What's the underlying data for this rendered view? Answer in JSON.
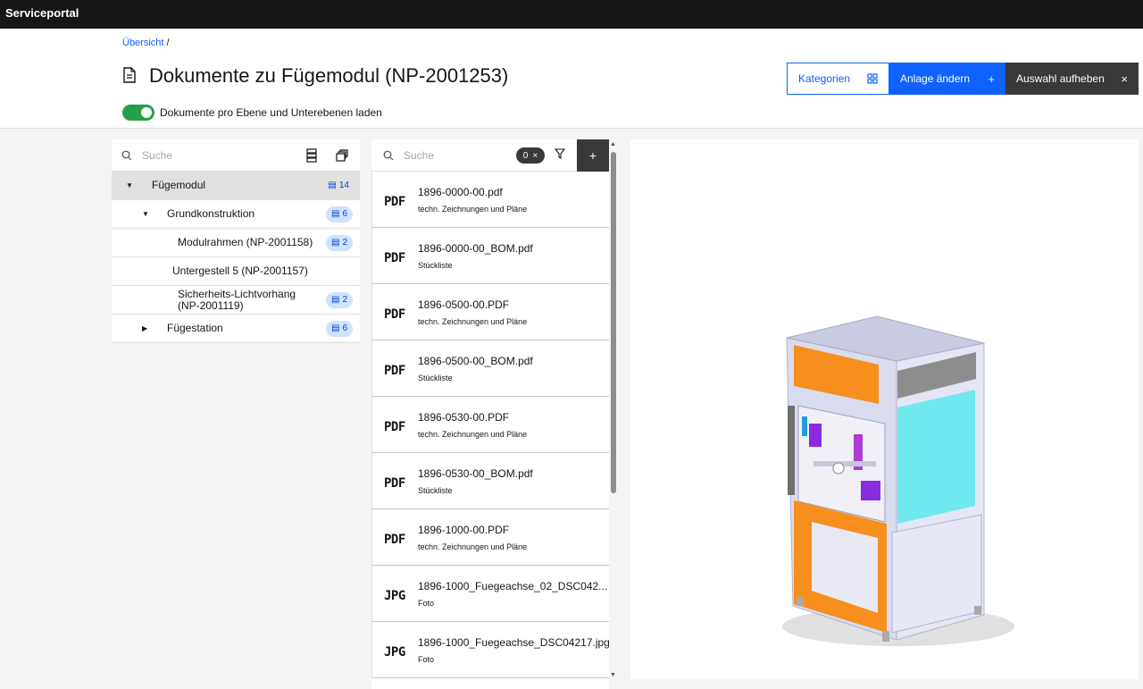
{
  "app": {
    "title": "Serviceportal"
  },
  "breadcrumb": {
    "link": "Übersicht",
    "separator": "/"
  },
  "page": {
    "title": "Dokumente zu Fügemodul (NP-2001253)"
  },
  "toggle": {
    "label": "Dokumente pro Ebene und Unterebenen laden",
    "checked": true
  },
  "actions": {
    "categories": "Kategorien",
    "change": "Anlage ändern",
    "change_icon": "+",
    "clear": "Auswahl aufheben",
    "clear_icon": "×"
  },
  "tree": {
    "search_placeholder": "Suche",
    "items": [
      {
        "label": "Fügemodul",
        "count": "14",
        "caret": "▼"
      },
      {
        "label": "Grundkonstruktion",
        "count": "6",
        "caret": "▼"
      },
      {
        "label": "Modulrahmen (NP-2001158)",
        "count": "2"
      },
      {
        "label": "Untergestell 5 (NP-2001157)"
      },
      {
        "label": "Sicherheits-Lichtvorhang (NP-2001119)",
        "count": "2"
      },
      {
        "label": "Fügestation",
        "count": "6",
        "caret": "▶"
      }
    ]
  },
  "documents": {
    "search_placeholder": "Suche",
    "filter_count": "0",
    "filter_clear": "×",
    "add": "+",
    "items": [
      {
        "type": "PDF",
        "name": "1896-0000-00.pdf",
        "category": "techn. Zeichnungen und Pläne"
      },
      {
        "type": "PDF",
        "name": "1896-0000-00_BOM.pdf",
        "category": "Stückliste"
      },
      {
        "type": "PDF",
        "name": "1896-0500-00.PDF",
        "category": "techn. Zeichnungen und Pläne"
      },
      {
        "type": "PDF",
        "name": "1896-0500-00_BOM.pdf",
        "category": "Stückliste"
      },
      {
        "type": "PDF",
        "name": "1896-0530-00.PDF",
        "category": "techn. Zeichnungen und Pläne"
      },
      {
        "type": "PDF",
        "name": "1896-0530-00_BOM.pdf",
        "category": "Stückliste"
      },
      {
        "type": "PDF",
        "name": "1896-1000-00.PDF",
        "category": "techn. Zeichnungen und Pläne"
      },
      {
        "type": "JPG",
        "name": "1896-1000_Fuegeachse_02_DSC042...",
        "category": "Foto"
      },
      {
        "type": "JPG",
        "name": "1896-1000_Fuegeachse_DSC04217.jpg",
        "category": "Foto"
      }
    ]
  },
  "colors": {
    "primary": "#0f62fe",
    "dark": "#161616",
    "success": "#24a148",
    "badge_bg": "#d0e2ff"
  }
}
